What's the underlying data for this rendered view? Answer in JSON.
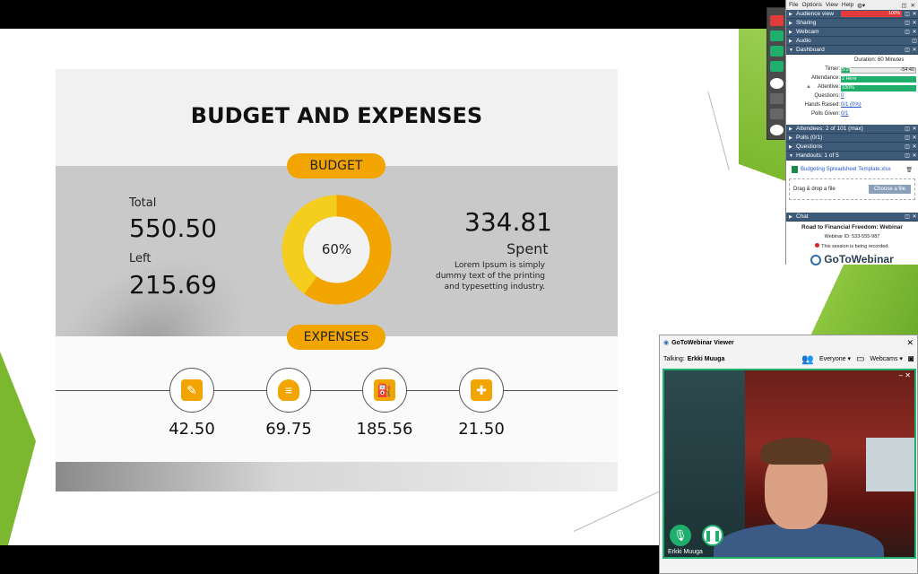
{
  "slide": {
    "title": "BUDGET AND EXPENSES",
    "budget_pill": "BUDGET",
    "expenses_pill": "EXPENSES",
    "total_label": "Total",
    "total_value": "550.50",
    "left_label": "Left",
    "left_value": "215.69",
    "spent_value": "334.81",
    "spent_label": "Spent",
    "spent_description": "Lorem Ipsum is simply dummy text of the printing and typesetting industry.",
    "donut_percent_label": "60%",
    "donut_fraction": 0.6,
    "colors": {
      "accent": "#f2a400",
      "accent_light": "#f5cd1f"
    },
    "expenses": [
      {
        "icon": "notepad-icon",
        "value": "42.50"
      },
      {
        "icon": "burger-icon",
        "value": "69.75"
      },
      {
        "icon": "fuel-pump-icon",
        "value": "185.56"
      },
      {
        "icon": "hospital-icon",
        "value": "21.50"
      }
    ]
  },
  "panel": {
    "menu": [
      "File",
      "Options",
      "View",
      "Help"
    ],
    "audience_view": "Audience view",
    "audience_level": "100%",
    "sharing": "Sharing",
    "webcam": "Webcam",
    "audio": "Audio",
    "dashboard": "Dashboard",
    "duration": "Duration: 60 Minutes",
    "timer_label": "Timer:",
    "timer_elapsed": "5:20",
    "timer_remaining": "-54:40",
    "attendance_label": "Attendance:",
    "attendance_value": "2 Here",
    "attentive_label": "Attentive:",
    "attentive_value": "100%",
    "questions_label": "Questions:",
    "questions_value": "0",
    "hands_label": "Hands Raised:",
    "hands_value": "0/1 (0%)",
    "polls_given_label": "Polls Given:",
    "polls_given_value": "0/1",
    "attendees": "Attendees: 2 of 101 (max)",
    "polls": "Polls (0/1)",
    "questions": "Questions",
    "handouts": "Handouts: 1 of 5",
    "handout_file": "Budgeting Spreadsheet Template.xlsx",
    "drag_drop": "Drag & drop a file",
    "choose_file": "Choose a file",
    "chat": "Chat",
    "webinar_title": "Road to Financial Freedom: Webinar",
    "webinar_id": "Webinar ID: 533-555-987",
    "recording_notice": "This session is being recorded.",
    "logo_text": "GoToWebinar",
    "colors": {
      "section": "#3e5a79",
      "green": "#1fae6b",
      "red": "#e23b3b"
    }
  },
  "viewer": {
    "title": "GoToWebinar Viewer",
    "talking_label": "Talking:",
    "talking_name": "Erkki Muuga",
    "everyone": "Everyone",
    "webcams": "Webcams",
    "participant_name": "Erkki Muuga"
  }
}
